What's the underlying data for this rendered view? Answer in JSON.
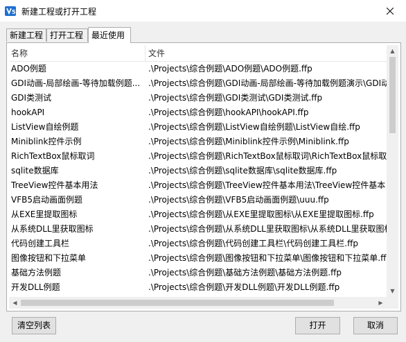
{
  "window": {
    "title": "新建工程或打开工程"
  },
  "tabs": [
    {
      "label": "新建工程",
      "active": false
    },
    {
      "label": "打开工程",
      "active": false
    },
    {
      "label": "最近使用",
      "active": true
    }
  ],
  "list": {
    "columns": [
      "名称",
      "文件"
    ],
    "rows": [
      {
        "name": "ADO例题",
        "file": ".\\Projects\\综合例题\\ADO例题\\ADO例题.ffp"
      },
      {
        "name": "GDI动画-局部绘画-等待加载例题...",
        "file": ".\\Projects\\综合例题\\GDI动画-局部绘画-等待加载例题演示\\GDI动"
      },
      {
        "name": "GDI类测试",
        "file": ".\\Projects\\综合例题\\GDI类测试\\GDI类测试.ffp"
      },
      {
        "name": "hookAPI",
        "file": ".\\Projects\\综合例题\\hookAPI\\hookAPI.ffp"
      },
      {
        "name": "ListView自绘例题",
        "file": ".\\Projects\\综合例题\\ListView自绘例题\\ListView自绘.ffp"
      },
      {
        "name": "Miniblink控件示例",
        "file": ".\\Projects\\综合例题\\Miniblink控件示例\\Miniblink.ffp"
      },
      {
        "name": "RichTextBox鼠标取词",
        "file": ".\\Projects\\综合例题\\RichTextBox鼠标取词\\RichTextBox鼠标取"
      },
      {
        "name": "sqlite数据库",
        "file": ".\\Projects\\综合例题\\sqlite数据库\\sqlite数据库.ffp"
      },
      {
        "name": "TreeView控件基本用法",
        "file": ".\\Projects\\综合例题\\TreeView控件基本用法\\TreeView控件基本"
      },
      {
        "name": "VFB5启动画面例题",
        "file": ".\\Projects\\综合例题\\VFB5启动画面例题\\uuu.ffp"
      },
      {
        "name": "从EXE里提取图标",
        "file": ".\\Projects\\综合例题\\从EXE里提取图标\\从EXE里提取图标.ffp"
      },
      {
        "name": "从系统DLL里获取图标",
        "file": ".\\Projects\\综合例题\\从系统DLL里获取图标\\从系统DLL里获取图标"
      },
      {
        "name": "代码创建工具栏",
        "file": ".\\Projects\\综合例题\\代码创建工具栏\\代码创建工具栏.ffp"
      },
      {
        "name": "图像按钮和下拉菜单",
        "file": ".\\Projects\\综合例题\\图像按钮和下拉菜单\\图像按钮和下拉菜单.ffp"
      },
      {
        "name": "基础方法例题",
        "file": ".\\Projects\\综合例题\\基础方法例题\\基础方法例题.ffp"
      },
      {
        "name": "开发DLL例题",
        "file": ".\\Projects\\综合例题\\开发DLL例题\\开发DLL例题.ffp"
      }
    ]
  },
  "buttons": {
    "clear": "清空列表",
    "open": "打开",
    "cancel": "取消"
  },
  "colors": {
    "app_icon": "#1e6fd0",
    "border": "#adadad",
    "button_face": "#e1e1e1"
  }
}
